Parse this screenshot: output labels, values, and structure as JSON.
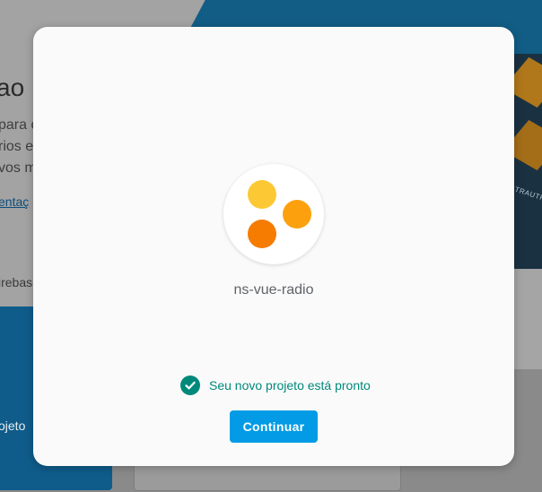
{
  "background": {
    "heading": "ao",
    "paragraph_lines": [
      "para c",
      "rios e",
      "vos m"
    ],
    "link": "entaç",
    "firebase_fragment": "irebas",
    "card_text": "ojeto",
    "illustration_text": "TRAUTH"
  },
  "dialog": {
    "project_name": "ns-vue-radio",
    "status_text": "Seu novo projeto está pronto",
    "continue_label": "Continuar",
    "status_icon": "check-circle-icon",
    "logo_icon": "project-dots-icon"
  },
  "colors": {
    "accent": "#039be5",
    "status_green": "#00897b",
    "dot_1": "#fcc834",
    "dot_2": "#fca10d",
    "dot_3": "#f57c00"
  }
}
